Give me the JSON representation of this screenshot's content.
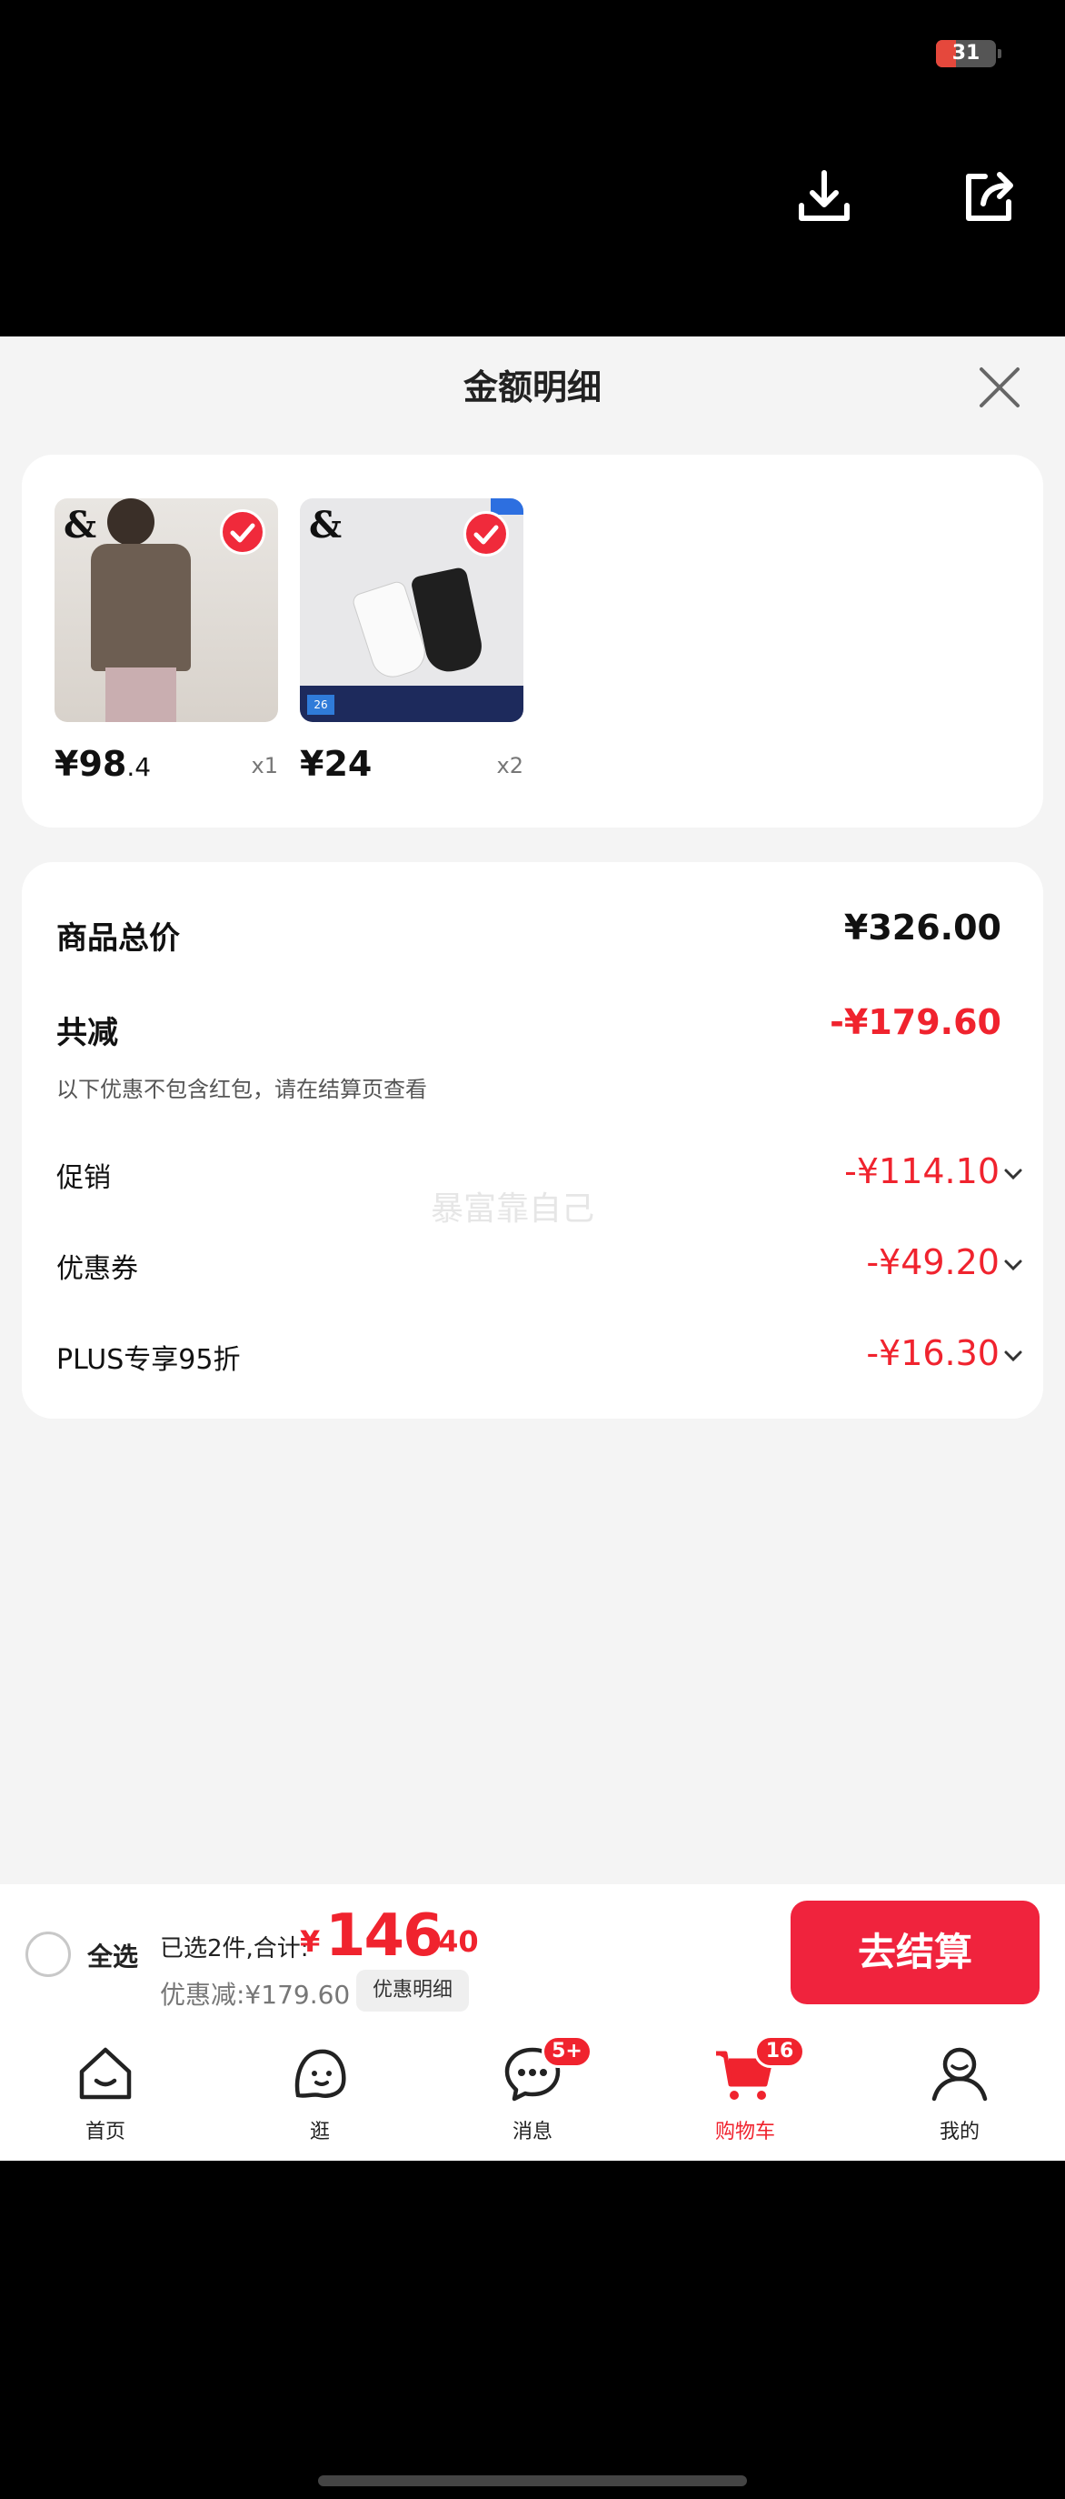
{
  "status": {
    "battery": "31"
  },
  "sheet": {
    "title": "金额明细"
  },
  "products": [
    {
      "price_symbol": "¥",
      "price_int": "98",
      "price_dec": ".4",
      "qty": "x1",
      "brand": "&"
    },
    {
      "price_symbol": "¥",
      "price_int": "24",
      "price_dec": "",
      "qty": "x2",
      "brand": "&"
    }
  ],
  "summary": {
    "total_label": "商品总价",
    "total_value": "¥326.00",
    "reduce_label": "共减",
    "reduce_value": "-¥179.60",
    "note": "以下优惠不包含红包，请在结算页查看",
    "watermark": "暴富靠自己",
    "rows": [
      {
        "label": "促销",
        "value": "-¥114.10"
      },
      {
        "label": "优惠券",
        "value": "-¥49.20"
      },
      {
        "label": "PLUS专享95折",
        "value": "-¥16.30"
      }
    ]
  },
  "checkout": {
    "select_all": "全选",
    "selected": "已选2件,合计:",
    "currency": "¥",
    "amount_int": "146",
    "amount_dec": ".40",
    "discount": "优惠减:¥179.60",
    "detail_btn": "优惠明细",
    "submit": "去结算"
  },
  "tabs": [
    {
      "label": "首页",
      "icon": "home-icon"
    },
    {
      "label": "逛",
      "icon": "browse-icon"
    },
    {
      "label": "消息",
      "icon": "message-icon",
      "badge": "5+"
    },
    {
      "label": "购物车",
      "icon": "cart-icon",
      "badge": "16",
      "active": true
    },
    {
      "label": "我的",
      "icon": "profile-icon"
    }
  ],
  "colors": {
    "accent": "#f0232e",
    "sheet_bg": "#f4f4f4"
  }
}
